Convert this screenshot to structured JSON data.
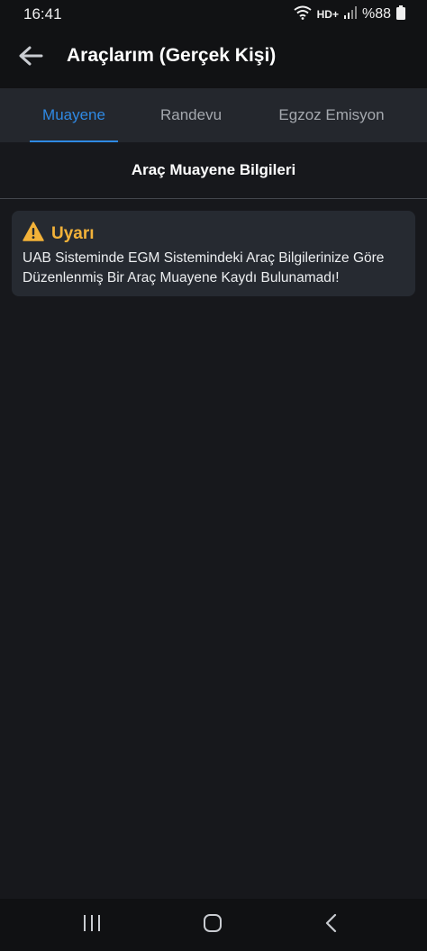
{
  "status_bar": {
    "time": "16:41",
    "network_label": "HD+",
    "battery_percent": "%88",
    "icons": [
      "wifi-icon",
      "hd-signal-icon",
      "cellular-signal-icon",
      "battery-icon"
    ]
  },
  "app_bar": {
    "back_icon": "arrow-left-icon",
    "title": "Araçlarım (Gerçek Kişi)"
  },
  "tabs": [
    {
      "label": "Muayene",
      "active": true
    },
    {
      "label": "Randevu",
      "active": false
    },
    {
      "label": "Egzoz Emisyon",
      "active": false
    }
  ],
  "section": {
    "title": "Araç Muayene Bilgileri"
  },
  "alert": {
    "icon": "warning-icon",
    "title": "Uyarı",
    "message": "UAB Sisteminde EGM Sistemindeki Araç Bilgilerinize Göre Düzenlenmiş Bir Araç Muayene Kaydı Bulunamadı!"
  },
  "nav_bar": {
    "icons": [
      "recent-apps-icon",
      "home-icon",
      "back-nav-icon"
    ]
  },
  "colors": {
    "background": "#17181c",
    "tab_bar": "#24272d",
    "accent": "#2f89e3",
    "warning": "#f3b239",
    "card": "#262a31"
  }
}
